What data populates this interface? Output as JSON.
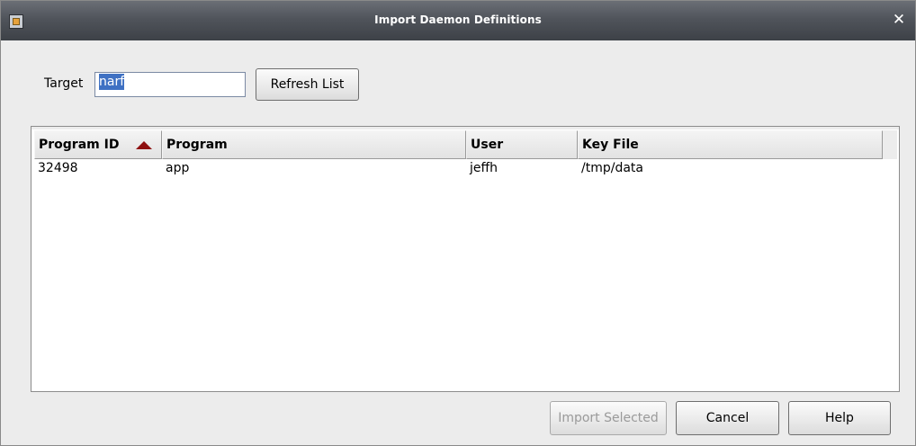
{
  "window": {
    "title": "Import Daemon Definitions",
    "close_glyph": "✕",
    "icon": "app-window-icon"
  },
  "target": {
    "label": "Target",
    "value": "narf",
    "selected_text": "narf"
  },
  "refresh": {
    "label": "Refresh List"
  },
  "table": {
    "columns": [
      "Program ID",
      "Program",
      "User",
      "Key File"
    ],
    "sort": {
      "column": "Program ID",
      "direction": "ascending",
      "color": "#8e1010"
    },
    "rows": [
      {
        "program_id": "32498",
        "program": "app",
        "user": "jeffh",
        "key_file": "/tmp/data"
      }
    ]
  },
  "buttons": {
    "import_selected": {
      "label": "Import Selected",
      "enabled": false
    },
    "cancel": {
      "label": "Cancel"
    },
    "help": {
      "label": "Help"
    }
  },
  "colors": {
    "titlebar": "#50545b",
    "selection": "#3f71c3",
    "disabled_text": "#9a9a9a"
  }
}
